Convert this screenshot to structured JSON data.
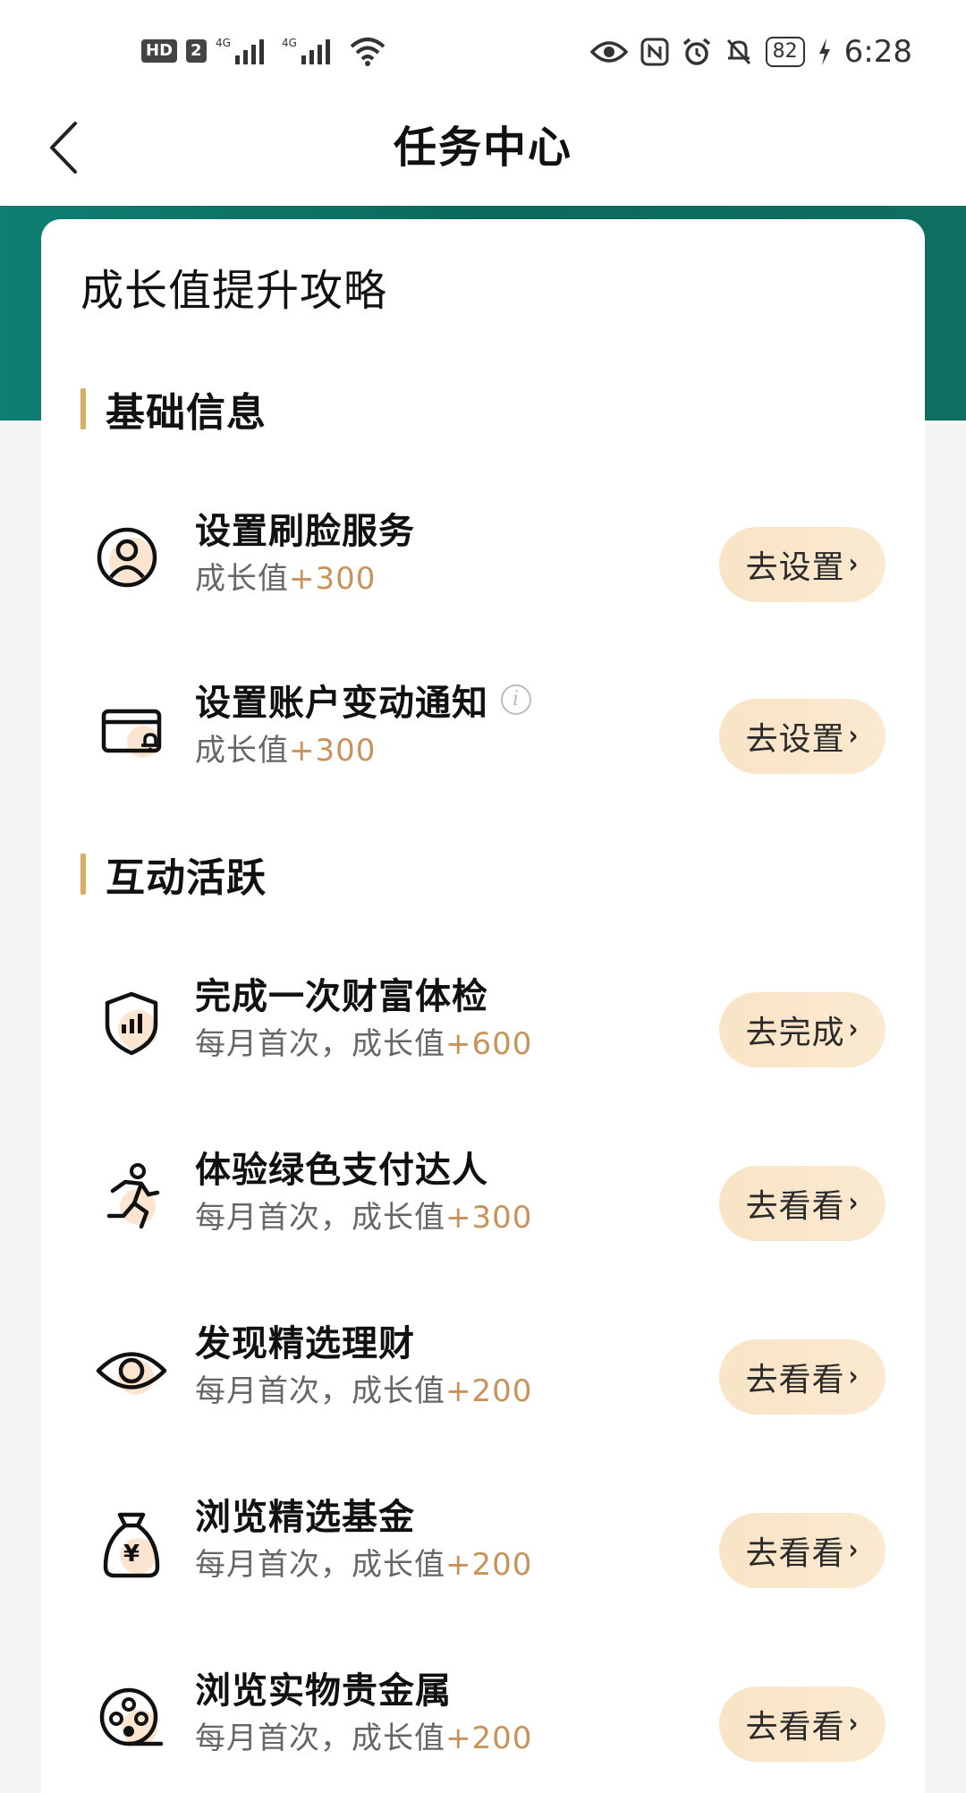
{
  "status_bar": {
    "left_badges": [
      "HD",
      "2"
    ],
    "network_1": "4G",
    "network_2": "4G",
    "battery": "82",
    "time": "6:28"
  },
  "nav": {
    "title": "任务中心"
  },
  "card": {
    "title": "成长值提升攻略",
    "sections": [
      {
        "label": "基础信息"
      },
      {
        "label": "互动活跃"
      }
    ],
    "tasks": [
      {
        "name": "设置刷脸服务",
        "sub_prefix": "成长值",
        "points": "+300",
        "button": "去设置",
        "icon": "face-id-icon"
      },
      {
        "name": "设置账户变动通知",
        "sub_prefix": "成长值",
        "points": "+300",
        "button": "去设置",
        "icon": "card-bell-icon",
        "info_icon": "i"
      },
      {
        "name": "完成一次财富体检",
        "sub_prefix": "每月首次，成长值",
        "points": "+600",
        "button": "去完成",
        "icon": "shield-chart-icon"
      },
      {
        "name": "体验绿色支付达人",
        "sub_prefix": "每月首次，成长值",
        "points": "+300",
        "button": "去看看",
        "icon": "running-person-icon"
      },
      {
        "name": "发现精选理财",
        "sub_prefix": "每月首次，成长值",
        "points": "+200",
        "button": "去看看",
        "icon": "eye-icon"
      },
      {
        "name": "浏览精选基金",
        "sub_prefix": "每月首次，成长值",
        "points": "+200",
        "button": "去看看",
        "icon": "money-bag-icon"
      },
      {
        "name": "浏览实物贵金属",
        "sub_prefix": "每月首次，成长值",
        "points": "+200",
        "button": "去看看",
        "icon": "film-reel-icon"
      }
    ]
  },
  "colors": {
    "accent_green": "#0e7f72",
    "gold": "#d6b060",
    "points": "#c8925a",
    "button_bg": "#f8e4c6"
  }
}
